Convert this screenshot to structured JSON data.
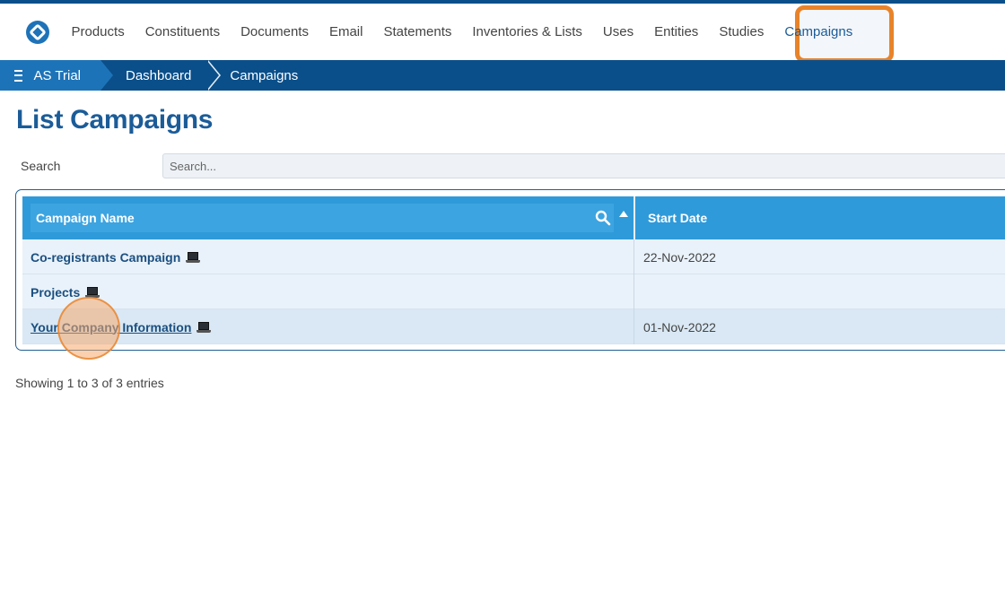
{
  "topnav": {
    "items": [
      {
        "label": "Products"
      },
      {
        "label": "Constituents"
      },
      {
        "label": "Documents"
      },
      {
        "label": "Email"
      },
      {
        "label": "Statements"
      },
      {
        "label": "Inventories & Lists"
      },
      {
        "label": "Uses"
      },
      {
        "label": "Entities"
      },
      {
        "label": "Studies"
      },
      {
        "label": "Campaigns",
        "active": true
      }
    ],
    "highlight_color": "#e8832a"
  },
  "breadcrumb": {
    "items": [
      {
        "label": "AS Trial"
      },
      {
        "label": "Dashboard"
      },
      {
        "label": "Campaigns"
      }
    ]
  },
  "page": {
    "title": "List Campaigns"
  },
  "search": {
    "label": "Search",
    "placeholder": "Search...",
    "value": ""
  },
  "table": {
    "columns": [
      {
        "label": "Campaign Name",
        "sort": "ascending"
      },
      {
        "label": "Start Date"
      }
    ],
    "rows": [
      {
        "name": "Co-registrants Campaign",
        "start_date": "22-Nov-2022"
      },
      {
        "name": "Projects",
        "start_date": ""
      },
      {
        "name": "Your Company Information",
        "start_date": "01-Nov-2022"
      }
    ]
  },
  "footer": {
    "entries_info": "Showing 1 to 3 of 3 entries"
  },
  "colors": {
    "brand_dark": "#0a4f8a",
    "brand": "#1d73b8",
    "header_blue": "#2f9ad9",
    "title_blue": "#1b5c98"
  }
}
